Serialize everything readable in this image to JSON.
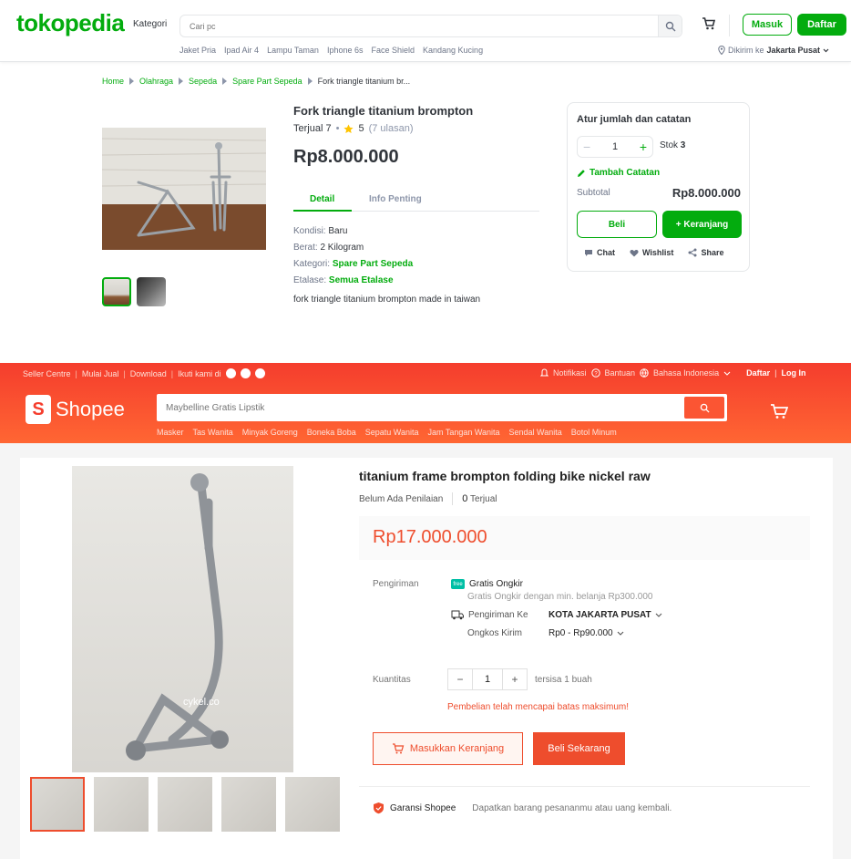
{
  "tokopedia": {
    "logo": "tokopedia",
    "kategori": "Kategori",
    "search_placeholder": "Cari pc",
    "masuk": "Masuk",
    "daftar": "Daftar",
    "quick_links": [
      "Jaket Pria",
      "Ipad Air 4",
      "Lampu Taman",
      "Iphone 6s",
      "Face Shield",
      "Kandang Kucing"
    ],
    "deliver_prefix": "Dikirim ke",
    "deliver_city": "Jakarta Pusat",
    "breadcrumb": [
      "Home",
      "Olahraga",
      "Sepeda",
      "Spare Part Sepeda"
    ],
    "breadcrumb_current": "Fork triangle titanium br...",
    "product": {
      "title": "Fork triangle titanium brompton",
      "sold": "Terjual 7",
      "rating": "5",
      "reviews": "(7 ulasan)",
      "price": "Rp8.000.000",
      "tab_detail": "Detail",
      "tab_info": "Info Penting",
      "specs": [
        {
          "label": "Kondisi: ",
          "value": "Baru",
          "link": false
        },
        {
          "label": "Berat: ",
          "value": "2 Kilogram",
          "link": false
        },
        {
          "label": "Kategori: ",
          "value": "Spare Part Sepeda",
          "link": true
        },
        {
          "label": "Etalase: ",
          "value": "Semua Etalase",
          "link": true
        }
      ],
      "description": "fork triangle titanium brompton made in taiwan"
    },
    "order_box": {
      "title": "Atur jumlah dan catatan",
      "quantity": "1",
      "stock_label": "Stok",
      "stock_value": "3",
      "note": "Tambah Catatan",
      "subtotal_label": "Subtotal",
      "subtotal_value": "Rp8.000.000",
      "buy": "Beli",
      "add_cart": "+ Keranjang",
      "actions": [
        "Chat",
        "Wishlist",
        "Share"
      ]
    },
    "colors": {
      "brand": "#03ac0e"
    }
  },
  "shopee": {
    "topnav_left": [
      "Seller Centre",
      "Mulai Jual",
      "Download",
      "Ikuti kami di"
    ],
    "topnav_right": {
      "notif": "Notifikasi",
      "help": "Bantuan",
      "lang": "Bahasa Indonesia",
      "signup": "Daftar",
      "login": "Log In"
    },
    "logo": "Shopee",
    "search_placeholder": "Maybelline Gratis Lipstik",
    "quick_links": [
      "Masker",
      "Tas Wanita",
      "Minyak Goreng",
      "Boneka Boba",
      "Sepatu Wanita",
      "Jam Tangan Wanita",
      "Sendal Wanita",
      "Botol Minum"
    ],
    "product": {
      "title": "titanium frame brompton folding bike nickel raw",
      "no_rating": "Belum Ada Penilaian",
      "sold_num": "0",
      "sold_label": "Terjual",
      "price": "Rp17.000.000",
      "shipping_label": "Pengiriman",
      "free_ship": "Gratis Ongkir",
      "free_ship_badge": "free",
      "free_ship_note": "Gratis Ongkir dengan min. belanja Rp300.000",
      "ship_to_label": "Pengiriman Ke",
      "ship_to_value": "KOTA JAKARTA PUSAT",
      "ship_cost_label": "Ongkos Kirim",
      "ship_cost_value": "Rp0 - Rp90.000",
      "qty_label": "Kuantitas",
      "quantity": "1",
      "stock": "tersisa 1 buah",
      "warning": "Pembelian telah mencapai batas maksimum!",
      "add_cart": "Masukkan Keranjang",
      "buy_now": "Beli Sekarang",
      "guarantee": "Garansi Shopee",
      "guarantee_desc": "Dapatkan barang pesananmu atau uang kembali.",
      "watermark": "cykel.co"
    },
    "colors": {
      "brand": "#ee4d2d"
    }
  }
}
